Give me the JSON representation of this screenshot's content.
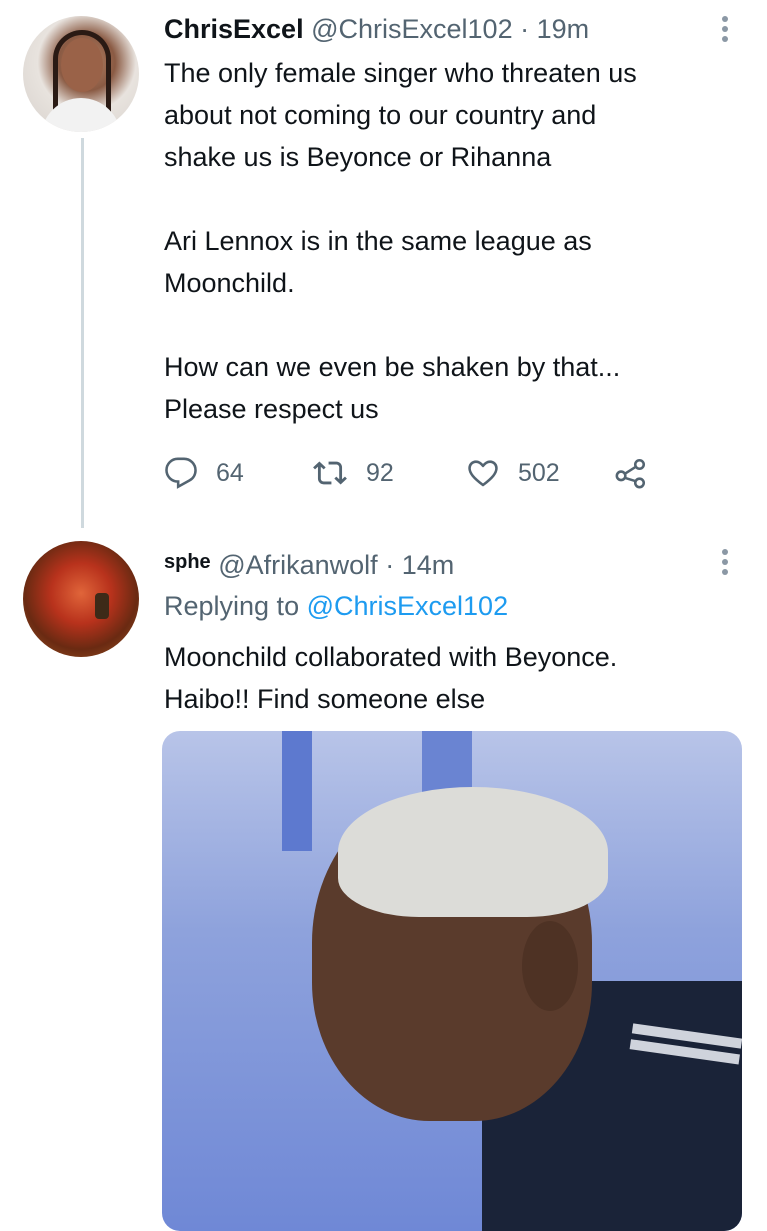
{
  "tweet1": {
    "display_name": "ChrisExcel",
    "handle": "@ChrisExcel102",
    "separator": "·",
    "time": "19m",
    "text": "The only female singer who threaten us\nabout not coming to our country and\nshake us is Beyonce or Rihanna\n\nAri Lennox is in the same league as\nMoonchild.\n\nHow can we even be shaken by that...\nPlease respect us",
    "actions": {
      "reply_count": "64",
      "retweet_count": "92",
      "like_count": "502"
    }
  },
  "tweet2": {
    "display_name": "sphe",
    "handle": "@Afrikanwolf",
    "separator": "·",
    "time": "14m",
    "replying_prefix": "Replying to",
    "replying_to": "@ChrisExcel102",
    "text": "Moonchild collaborated with Beyonce.\nHaibo!! Find someone else"
  },
  "colors": {
    "text_primary": "#0f1419",
    "text_secondary": "#536471",
    "link": "#1d9bf0",
    "thread_line": "#cfd9de"
  },
  "icons": [
    "reply-icon",
    "retweet-icon",
    "like-icon",
    "share-icon",
    "more-options-icon"
  ]
}
